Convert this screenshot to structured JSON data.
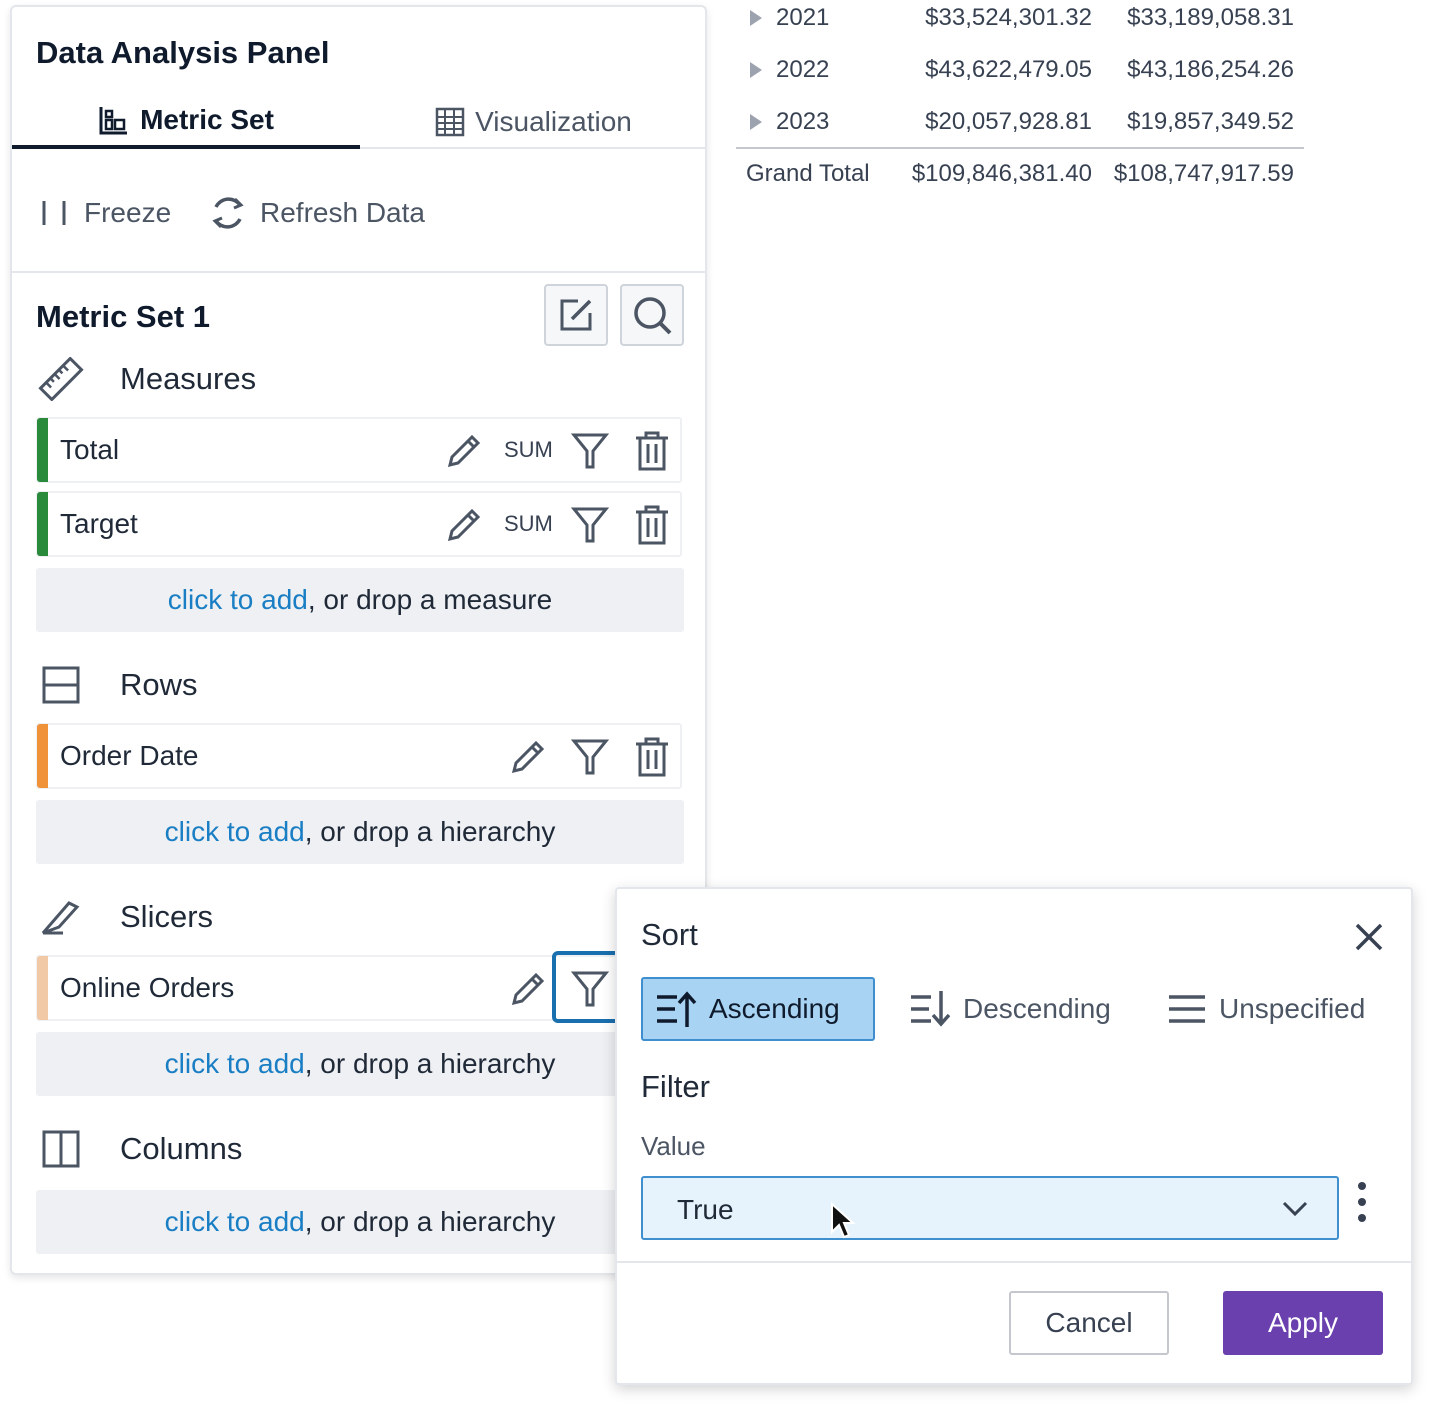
{
  "panel": {
    "title": "Data Analysis Panel",
    "tabs": [
      {
        "label": "Metric Set",
        "icon": "metric-set-icon",
        "active": true
      },
      {
        "label": "Visualization",
        "icon": "grid-table-icon",
        "active": false
      }
    ],
    "toolbar": {
      "freeze_label": "Freeze",
      "refresh_label": "Refresh Data"
    },
    "metric_set_title": "Metric Set 1",
    "sections": {
      "measures": {
        "title": "Measures",
        "icon": "ruler-icon",
        "items": [
          {
            "label": "Total",
            "aggregate": "SUM",
            "color": "#2a8a3c"
          },
          {
            "label": "Target",
            "aggregate": "SUM",
            "color": "#2a8a3c"
          }
        ],
        "drop": {
          "link": "click to add",
          "rest": ", or drop a measure"
        }
      },
      "rows": {
        "title": "Rows",
        "icon": "rows-icon",
        "items": [
          {
            "label": "Order Date",
            "color": "#f0923a"
          }
        ],
        "drop": {
          "link": "click to add",
          "rest": ", or drop a hierarchy"
        }
      },
      "slicers": {
        "title": "Slicers",
        "icon": "slicer-knife-icon",
        "items": [
          {
            "label": "Online Orders",
            "color": "#f2c9a6"
          }
        ],
        "drop": {
          "link": "click to add",
          "rest": ", or drop a hierarchy"
        }
      },
      "columns": {
        "title": "Columns",
        "icon": "columns-icon",
        "drop": {
          "link": "click to add",
          "rest": ", or drop a hierarchy"
        }
      }
    }
  },
  "table": {
    "rows": [
      {
        "label": "2021",
        "total": "$33,524,301.32",
        "target": "$33,189,058.31"
      },
      {
        "label": "2022",
        "total": "$43,622,479.05",
        "target": "$43,186,254.26"
      },
      {
        "label": "2023",
        "total": "$20,057,928.81",
        "target": "$19,857,349.52"
      }
    ],
    "grand_total": {
      "label": "Grand Total",
      "total": "$109,846,381.40",
      "target": "$108,747,917.59"
    }
  },
  "popup": {
    "sort_title": "Sort",
    "sort_options": [
      {
        "label": "Ascending",
        "selected": true
      },
      {
        "label": "Descending",
        "selected": false
      },
      {
        "label": "Unspecified",
        "selected": false
      }
    ],
    "filter_title": "Filter",
    "value_label": "Value",
    "value_selected": "True",
    "cancel_label": "Cancel",
    "apply_label": "Apply"
  },
  "colors": {
    "accent_blue": "#1a7ec4",
    "apply_purple": "#6a3fae",
    "selected_sort_bg": "#a8d3f2",
    "measure_green": "#2a8a3c",
    "rows_orange": "#f0923a",
    "slicer_peach": "#f2c9a6"
  }
}
